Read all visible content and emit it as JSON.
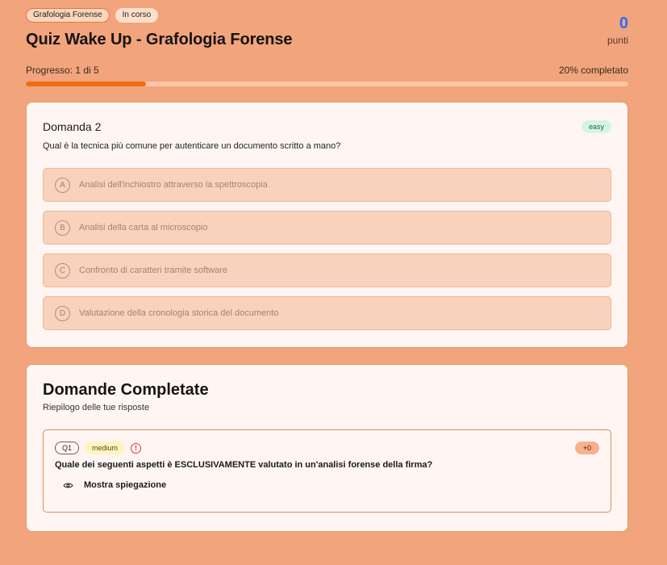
{
  "header": {
    "category_tag": "Grafologia Forense",
    "status_tag": "In corso",
    "title": "Quiz Wake Up - Grafologia Forense",
    "score_value": "0",
    "score_label": "punti"
  },
  "progress": {
    "label": "Progresso: 1 di 5",
    "percent_label": "20% completato",
    "fraction": 0.2
  },
  "question": {
    "number_label": "Domanda 2",
    "difficulty": "easy",
    "text": "Qual è la tecnica più comune per autenticare un documento scritto a mano?",
    "options": [
      {
        "letter": "A",
        "text": "Analisi dell'inchiostro attraverso la spettroscopia"
      },
      {
        "letter": "B",
        "text": "Analisi della carta al microscopio"
      },
      {
        "letter": "C",
        "text": "Confronto di caratteri tramite software"
      },
      {
        "letter": "D",
        "text": "Valutazione della cronologia storica del documento"
      }
    ]
  },
  "completed": {
    "title": "Domande Completate",
    "subtitle": "Riepilogo delle tue risposte",
    "items": [
      {
        "q_label": "Q1",
        "difficulty": "medium",
        "status_icon": "alert-circle-icon",
        "points": "+0",
        "question": "Quale dei seguenti aspetti è ESCLUSIVAMENTE valutato in un'analisi forense della firma?",
        "explain_label": "Mostra spiegazione"
      }
    ]
  },
  "colors": {
    "background": "#f2a47c",
    "accent_progress": "#ef6d12",
    "score_blue": "#2f6bff",
    "easy_badge": "#d5f5e3",
    "medium_badge": "#fff3c2",
    "alert_red": "#d93838"
  }
}
